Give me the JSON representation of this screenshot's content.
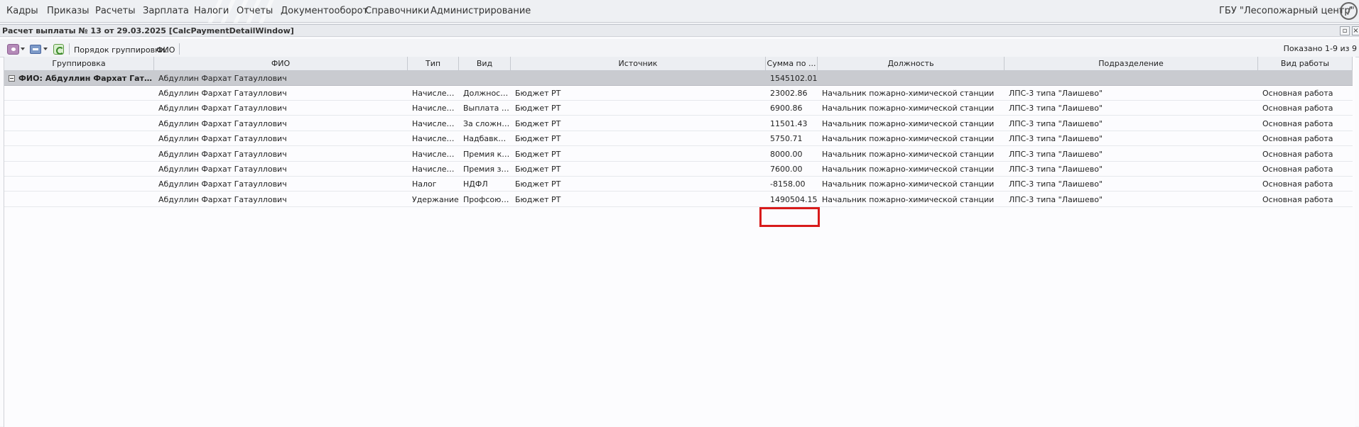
{
  "topmenu": {
    "items": [
      "Кадры",
      "Приказы",
      "Расчеты",
      "Зарплата",
      "Налоги",
      "Отчеты",
      "Документооборот",
      "Справочники",
      "Администрирование"
    ],
    "org": "ГБУ \"Лесопожарный центр\""
  },
  "window": {
    "title": "Расчет выплаты № 13 от 29.03.2025 [CalcPaymentDetailWindow]"
  },
  "toolbar": {
    "grouping_label": "Порядок группировки:",
    "grouping_value": "ФИО",
    "shown": "Показано 1-9 из 9"
  },
  "grid": {
    "columns": [
      "Группировка",
      "ФИО",
      "Тип",
      "Вид",
      "Источник",
      "Сумма по ...",
      "Должность",
      "Подразделение",
      "Вид работы"
    ],
    "group": {
      "label": "ФИО: Абдуллин Фархат Гатау...",
      "fio": "Абдуллин Фархат Гатауллович",
      "sum": "1545102.01"
    },
    "rows": [
      {
        "fio": "Абдуллин Фархат Гатауллович",
        "type": "Начисление",
        "kind": "Должност...",
        "source": "Бюджет РТ",
        "sum": "23002.86",
        "position": "Начальник пожарно-химической станции",
        "dept": "ЛПС-3 типа \"Лаишево\"",
        "work": "Основная работа"
      },
      {
        "fio": "Абдуллин Фархат Гатауллович",
        "type": "Начисление",
        "kind": "Выплата з...",
        "source": "Бюджет РТ",
        "sum": "6900.86",
        "position": "Начальник пожарно-химической станции",
        "dept": "ЛПС-3 типа \"Лаишево\"",
        "work": "Основная работа"
      },
      {
        "fio": "Абдуллин Фархат Гатауллович",
        "type": "Начисление",
        "kind": "За сложно...",
        "source": "Бюджет РТ",
        "sum": "11501.43",
        "position": "Начальник пожарно-химической станции",
        "dept": "ЛПС-3 типа \"Лаишево\"",
        "work": "Основная работа"
      },
      {
        "fio": "Абдуллин Фархат Гатауллович",
        "type": "Начисление",
        "kind": "Надбавка ...",
        "source": "Бюджет РТ",
        "sum": "5750.71",
        "position": "Начальник пожарно-химической станции",
        "dept": "ЛПС-3 типа \"Лаишево\"",
        "work": "Основная работа"
      },
      {
        "fio": "Абдуллин Фархат Гатауллович",
        "type": "Начисление",
        "kind": "Премия к ...",
        "source": "Бюджет РТ",
        "sum": "8000.00",
        "position": "Начальник пожарно-химической станции",
        "dept": "ЛПС-3 типа \"Лаишево\"",
        "work": "Основная работа"
      },
      {
        "fio": "Абдуллин Фархат Гатауллович",
        "type": "Начисление",
        "kind": "Премия за...",
        "source": "Бюджет РТ",
        "sum": "7600.00",
        "position": "Начальник пожарно-химической станции",
        "dept": "ЛПС-3 типа \"Лаишево\"",
        "work": "Основная работа"
      },
      {
        "fio": "Абдуллин Фархат Гатауллович",
        "type": "Налог",
        "kind": "НДФЛ",
        "source": "Бюджет РТ",
        "sum": "-8158.00",
        "position": "Начальник пожарно-химической станции",
        "dept": "ЛПС-3 типа \"Лаишево\"",
        "work": "Основная работа"
      },
      {
        "fio": "Абдуллин Фархат Гатауллович",
        "type": "Удержание",
        "kind": "Профсоюз...",
        "source": "Бюджет РТ",
        "sum": "1490504.15",
        "position": "Начальник пожарно-химической станции",
        "dept": "ЛПС-3 типа \"Лаишево\"",
        "work": "Основная работа"
      }
    ]
  },
  "colors": {
    "highlight": "#d81b1b",
    "group_row": "#c9cbd0"
  }
}
